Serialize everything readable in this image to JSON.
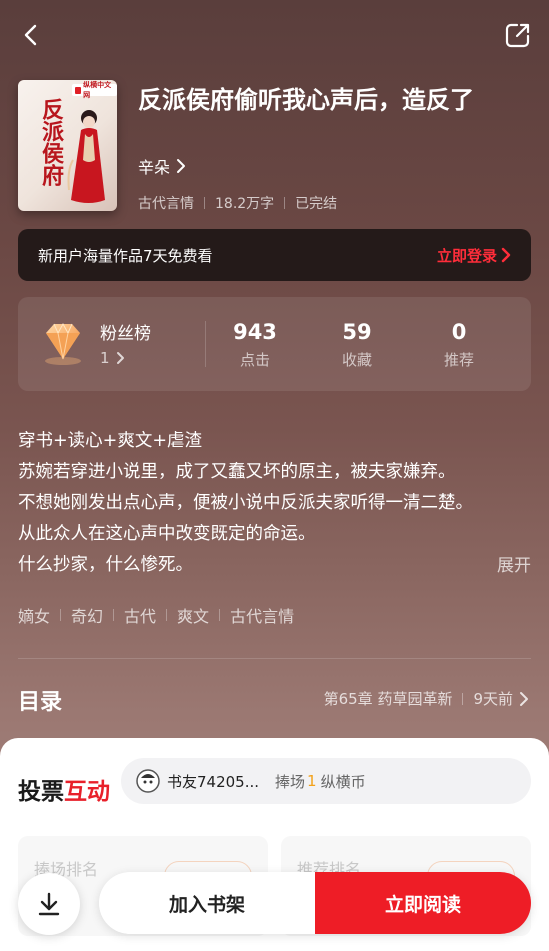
{
  "nav": {
    "back_icon": "chevron-left-icon",
    "share_icon": "share-icon"
  },
  "book": {
    "cover": {
      "badge": "纵横中文网",
      "title": "反派侯府"
    },
    "title": "反派侯府偷听我心声后，造反了",
    "author": "辛朵",
    "meta": [
      "古代言情",
      "18.2万字",
      "已完结"
    ]
  },
  "promo": {
    "text": "新用户海量作品7天免费看",
    "login": "立即登录"
  },
  "stats": {
    "fans_label": "粉丝榜",
    "fans_rank": "1",
    "items": [
      {
        "value": "943",
        "label": "点击"
      },
      {
        "value": "59",
        "label": "收藏"
      },
      {
        "value": "0",
        "label": "推荐"
      }
    ]
  },
  "synopsis": {
    "lines": [
      "穿书+读心+爽文+虐渣",
      "苏婉若穿进小说里，成了又蠢又坏的原主，被夫家嫌弃。",
      "不想她刚发出点心声，便被小说中反派夫家听得一清二楚。",
      "从此众人在这心声中改变既定的命运。",
      "什么抄家，什么惨死。"
    ],
    "expand": "展开"
  },
  "tags": [
    "嫡女",
    "奇幻",
    "古代",
    "爽文",
    "古代言情"
  ],
  "toc": {
    "title": "目录",
    "latest": "第65章 药草园革新",
    "time": "9天前"
  },
  "vote": {
    "title_a": "投票",
    "title_b": "互动",
    "user": "书友74205...",
    "action": "捧场",
    "count": "1",
    "currency": "纵横币",
    "rank_left": "捧场排名",
    "rank_right": "推荐排名"
  },
  "bottom": {
    "shelf": "加入书架",
    "read": "立即阅读",
    "download_icon": "download-icon"
  },
  "colors": {
    "accent": "#ee1d26",
    "login": "#ff2d3a",
    "count": "#f3a21b"
  }
}
